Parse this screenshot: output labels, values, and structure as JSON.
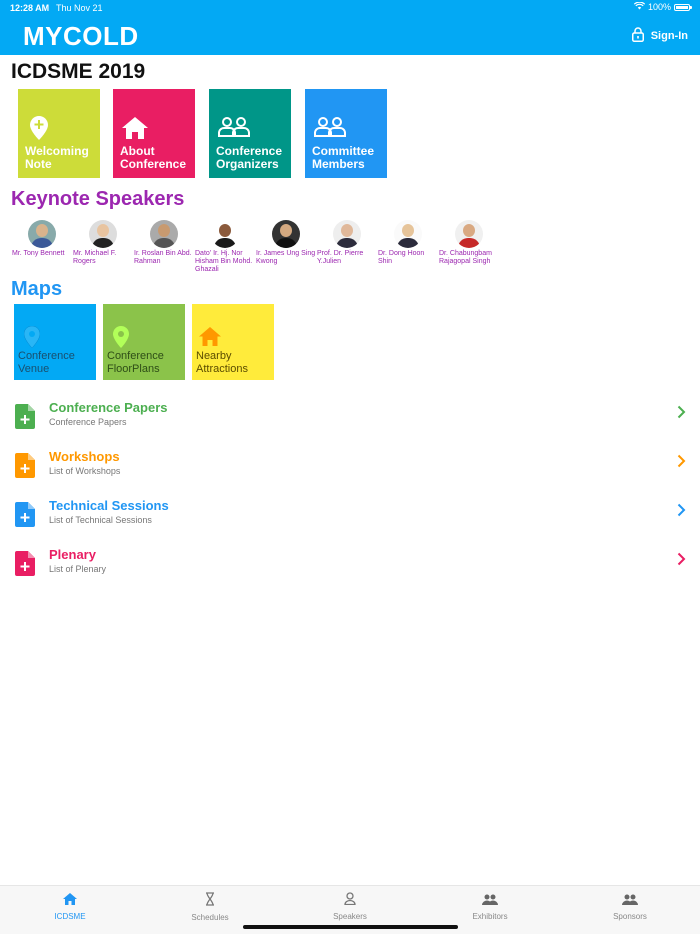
{
  "status_bar": {
    "time": "12:28 AM",
    "date": "Thu Nov 21",
    "battery": "100%"
  },
  "header": {
    "app_title": "MYCOLD",
    "signin_label": "Sign-In"
  },
  "conference_title": "ICDSME 2019",
  "tiles": [
    {
      "label": "Welcoming Note",
      "icon": "map-pin-plus-icon",
      "color": "#cddc39"
    },
    {
      "label": "About Conference",
      "icon": "home-icon",
      "color": "#e91e63"
    },
    {
      "label": "Conference Organizers",
      "icon": "people-icon",
      "color": "#009688"
    },
    {
      "label": "Committee Members",
      "icon": "people-icon",
      "color": "#2196f3"
    }
  ],
  "keynote": {
    "title": "Keynote Speakers",
    "speakers": [
      {
        "name": "Mr. Tony Bennett"
      },
      {
        "name": "Mr. Michael F. Rogers"
      },
      {
        "name": "Ir. Roslan Bin Abd. Rahman"
      },
      {
        "name": "Dato' Ir. Hj. Nor Hisham Bin Mohd. Ghazali"
      },
      {
        "name": "Ir. James Ung Sing Kwong"
      },
      {
        "name": "Prof. Dr. Pierre Y.Julien"
      },
      {
        "name": "Dr. Dong Hoon Shin"
      },
      {
        "name": "Dr. Chabungbam Rajagopal Singh"
      }
    ]
  },
  "maps": {
    "title": "Maps",
    "tiles": [
      {
        "label": "Conference Venue",
        "icon": "map-pin-icon",
        "color": "#03a9f4"
      },
      {
        "label": "Conference FloorPlans",
        "icon": "map-pin-icon",
        "color": "#8bc34a"
      },
      {
        "label": "Nearby Attractions",
        "icon": "home-icon",
        "color": "#ffeb3b"
      }
    ]
  },
  "list": [
    {
      "title": "Conference Papers",
      "subtitle": "Conference Papers",
      "color": "#4caf50"
    },
    {
      "title": "Workshops",
      "subtitle": "List of Workshops",
      "color": "#ff9800"
    },
    {
      "title": "Technical Sessions",
      "subtitle": "List of Technical Sessions",
      "color": "#2196f3"
    },
    {
      "title": "Plenary",
      "subtitle": "List of Plenary",
      "color": "#e91e63"
    }
  ],
  "tabs": [
    {
      "label": "ICDSME",
      "icon": "home-icon",
      "active": true
    },
    {
      "label": "Schedules",
      "icon": "hourglass-icon",
      "active": false
    },
    {
      "label": "Speakers",
      "icon": "person-icon",
      "active": false
    },
    {
      "label": "Exhibitors",
      "icon": "people-icon",
      "active": false
    },
    {
      "label": "Sponsors",
      "icon": "people-icon",
      "active": false
    }
  ],
  "colors": {
    "accent": "#03a9f4",
    "tab_active": "#2196f3"
  }
}
